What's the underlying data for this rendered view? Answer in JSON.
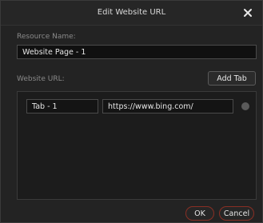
{
  "dialog": {
    "title": "Edit Website URL",
    "close_icon": "close-icon"
  },
  "resource": {
    "label": "Resource Name:",
    "value": "Website Page - 1"
  },
  "website": {
    "label": "Website URL:",
    "add_tab_label": "Add Tab",
    "tabs": [
      {
        "name": "Tab - 1",
        "url": "https://www.bing.com/"
      }
    ]
  },
  "footer": {
    "ok_label": "OK",
    "cancel_label": "Cancel"
  },
  "colors": {
    "accent": "#8a2f24",
    "background": "#232323",
    "field_background": "#101010"
  }
}
